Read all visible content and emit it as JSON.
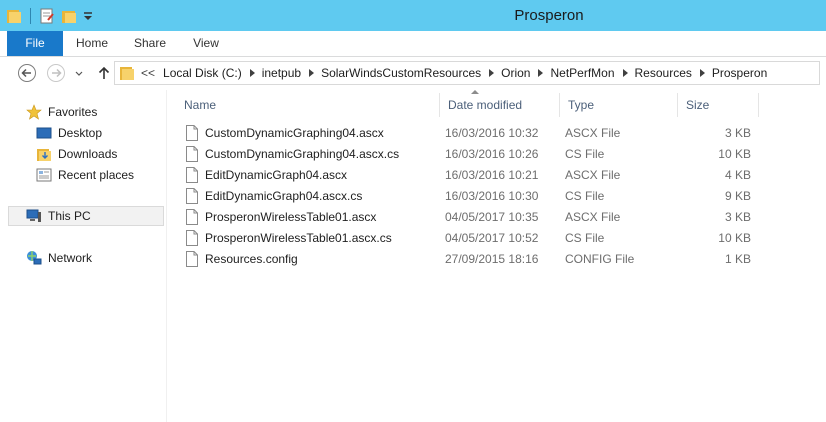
{
  "window": {
    "title": "Prosperon"
  },
  "colors": {
    "titlebar": "#5fcaf0",
    "file_tab": "#1979ca",
    "header_text": "#4c607a"
  },
  "ribbon": {
    "tabs": [
      {
        "label": "File"
      },
      {
        "label": "Home"
      },
      {
        "label": "Share"
      },
      {
        "label": "View"
      }
    ]
  },
  "address": {
    "overflow": "<<",
    "crumbs": [
      "Local Disk (C:)",
      "inetpub",
      "SolarWindsCustomResources",
      "Orion",
      "NetPerfMon",
      "Resources",
      "Prosperon"
    ]
  },
  "navpane": {
    "favorites": "Favorites",
    "desktop": "Desktop",
    "downloads": "Downloads",
    "recent": "Recent places",
    "thispc": "This PC",
    "network": "Network"
  },
  "columns": {
    "name": "Name",
    "date": "Date modified",
    "type": "Type",
    "size": "Size"
  },
  "files": [
    {
      "name": "CustomDynamicGraphing04.ascx",
      "date": "16/03/2016 10:32",
      "type": "ASCX File",
      "size": "3 KB"
    },
    {
      "name": "CustomDynamicGraphing04.ascx.cs",
      "date": "16/03/2016 10:26",
      "type": "CS File",
      "size": "10 KB"
    },
    {
      "name": "EditDynamicGraph04.ascx",
      "date": "16/03/2016 10:21",
      "type": "ASCX File",
      "size": "4 KB"
    },
    {
      "name": "EditDynamicGraph04.ascx.cs",
      "date": "16/03/2016 10:30",
      "type": "CS File",
      "size": "9 KB"
    },
    {
      "name": "ProsperonWirelessTable01.ascx",
      "date": "04/05/2017 10:35",
      "type": "ASCX File",
      "size": "3 KB"
    },
    {
      "name": "ProsperonWirelessTable01.ascx.cs",
      "date": "04/05/2017 10:52",
      "type": "CS File",
      "size": "10 KB"
    },
    {
      "name": "Resources.config",
      "date": "27/09/2015 18:16",
      "type": "CONFIG File",
      "size": "1 KB"
    }
  ]
}
